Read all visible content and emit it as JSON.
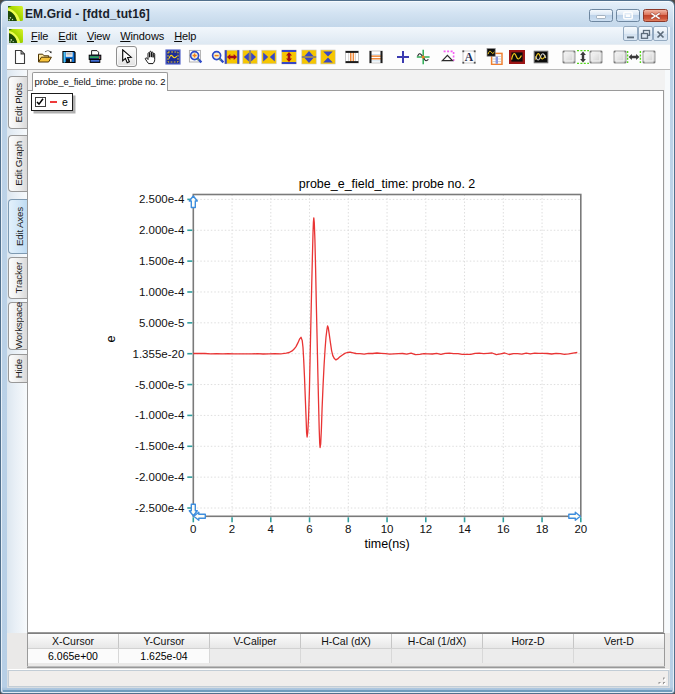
{
  "window": {
    "title": "EM.Grid - [fdtd_tut16]",
    "caption_buttons": [
      "minimize",
      "maximize",
      "close"
    ]
  },
  "menu": {
    "items": [
      {
        "label": "File",
        "underline": 0
      },
      {
        "label": "Edit",
        "underline": 0
      },
      {
        "label": "View",
        "underline": 0
      },
      {
        "label": "Windows",
        "underline": 0
      },
      {
        "label": "Help",
        "underline": 0
      }
    ],
    "mdi_buttons": [
      "minimize",
      "restore",
      "close"
    ]
  },
  "toolbar": {
    "buttons": [
      {
        "icon": "new-document"
      },
      {
        "icon": "open-folder"
      },
      {
        "icon": "save-floppy"
      },
      {
        "icon": "print"
      },
      {
        "icon": "select-arrow",
        "pressed": true
      },
      {
        "icon": "pan-hand"
      },
      {
        "icon": "zoom-region"
      },
      {
        "icon": "zoom-in"
      },
      {
        "icon": "zoom-out"
      },
      {
        "icon": "expand-x"
      },
      {
        "icon": "stretch-x"
      },
      {
        "icon": "shrink-x"
      },
      {
        "icon": "expand-y"
      },
      {
        "icon": "stretch-y"
      },
      {
        "icon": "shrink-y"
      },
      {
        "icon": "vertical-gridlines"
      },
      {
        "icon": "horizontal-gridlines"
      },
      {
        "icon": "crosshair"
      },
      {
        "icon": "tracker"
      },
      {
        "icon": "caliper"
      },
      {
        "icon": "text-annotation"
      },
      {
        "icon": "plot-table"
      },
      {
        "icon": "edit-plot"
      },
      {
        "icon": "overlay-plots"
      },
      {
        "icon": "align-box"
      },
      {
        "icon": "distribute-vertical"
      },
      {
        "icon": "align-box"
      },
      {
        "icon": "align-box"
      },
      {
        "icon": "distribute-horizontal"
      },
      {
        "icon": "align-box"
      }
    ]
  },
  "sidebar": {
    "tabs": [
      {
        "label": "Edit Plots",
        "selected": false
      },
      {
        "label": "Edit Graph",
        "selected": false
      },
      {
        "label": "Edit Axes",
        "selected": true
      },
      {
        "label": "Tracker",
        "selected": false
      },
      {
        "label": "Workspace",
        "selected": false
      },
      {
        "label": "Hide",
        "selected": false
      }
    ]
  },
  "document_tab": {
    "label": "probe_e_field_time: probe no. 2"
  },
  "legend": {
    "checked": true,
    "series_label": "e",
    "line_color": "#e93434"
  },
  "chart_data": {
    "type": "line",
    "title": "probe_e_field_time: probe no. 2",
    "xlabel": "time(ns)",
    "ylabel": "e",
    "xlim": [
      0,
      20
    ],
    "ylim": [
      -0.00026,
      0.000258
    ],
    "x_ticks": [
      0,
      2,
      4,
      6,
      8,
      10,
      12,
      14,
      16,
      18,
      20
    ],
    "y_ticks": [
      {
        "label": "2.500e-4",
        "value": 0.00025
      },
      {
        "label": "2.000e-4",
        "value": 0.0002
      },
      {
        "label": "1.500e-4",
        "value": 0.00015
      },
      {
        "label": "1.000e-4",
        "value": 0.0001
      },
      {
        "label": "5.000e-5",
        "value": 5e-05
      },
      {
        "label": "1.355e-20",
        "value": 0.0
      },
      {
        "label": "-5.000e-5",
        "value": -5e-05
      },
      {
        "label": "-1.000e-4",
        "value": -0.0001
      },
      {
        "label": "-1.500e-4",
        "value": -0.00015
      },
      {
        "label": "-2.000e-4",
        "value": -0.0002
      },
      {
        "label": "-2.500e-4",
        "value": -0.00025
      }
    ],
    "grid": "dotted",
    "legend_position": "floating-top-left",
    "series": [
      {
        "name": "e",
        "color": "#e93434",
        "points": [
          [
            0.0,
            4e-07
          ],
          [
            0.3,
            4e-07
          ],
          [
            0.6,
            4e-07
          ],
          [
            0.9,
            -4e-07
          ],
          [
            1.2,
            1e-07
          ],
          [
            1.5,
            -1e-07
          ],
          [
            1.8,
            0.0
          ],
          [
            2.1,
            -4e-07
          ],
          [
            2.4,
            -3e-07
          ],
          [
            2.7,
            -1e-07
          ],
          [
            3.0,
            -3e-07
          ],
          [
            3.3,
            -0.0
          ],
          [
            3.6,
            -5e-07
          ],
          [
            3.9,
            -4e-07
          ],
          [
            4.2,
            2e-07
          ],
          [
            4.5,
            -1e-07
          ],
          [
            4.6,
            0.0
          ],
          [
            4.8,
            8e-07
          ],
          [
            4.95,
            2e-06
          ],
          [
            5.1,
            4.5e-06
          ],
          [
            5.2,
            7.5e-06
          ],
          [
            5.3,
            1.15e-05
          ],
          [
            5.4,
            1.75e-05
          ],
          [
            5.48,
            2.35e-05
          ],
          [
            5.56,
            2.65e-05
          ],
          [
            5.62,
            2.15e-05
          ],
          [
            5.66,
            1e-05
          ],
          [
            5.7,
            -1e-05
          ],
          [
            5.74,
            -3.8e-05
          ],
          [
            5.78,
            -7.2e-05
          ],
          [
            5.82,
            -0.000105
          ],
          [
            5.85,
            -0.000128
          ],
          [
            5.875,
            -0.000135
          ],
          [
            5.91,
            -0.000127
          ],
          [
            5.95,
            -0.000102
          ],
          [
            5.99,
            -6e-05
          ],
          [
            6.03,
            -7e-06
          ],
          [
            6.07,
            5.2e-05
          ],
          [
            6.11,
            0.00011
          ],
          [
            6.145,
            0.000157
          ],
          [
            6.18,
            0.000195
          ],
          [
            6.2,
            0.000213
          ],
          [
            6.22,
            0.00022
          ],
          [
            6.245,
            0.000212
          ],
          [
            6.275,
            0.000185
          ],
          [
            6.31,
            0.000138
          ],
          [
            6.35,
            8.2e-05
          ],
          [
            6.39,
            2.5e-05
          ],
          [
            6.43,
            -3.5e-05
          ],
          [
            6.465,
            -8.2e-05
          ],
          [
            6.5,
            -0.000122
          ],
          [
            6.525,
            -0.000145
          ],
          [
            6.545,
            -0.000152
          ],
          [
            6.575,
            -0.000146
          ],
          [
            6.61,
            -0.000122
          ],
          [
            6.65,
            -8.8e-05
          ],
          [
            6.7,
            -5e-05
          ],
          [
            6.75,
            -1.8e-05
          ],
          [
            6.8,
            8e-06
          ],
          [
            6.85,
            2.7e-05
          ],
          [
            6.9,
            4e-05
          ],
          [
            6.93,
            4.5e-05
          ],
          [
            6.97,
            4.2e-05
          ],
          [
            7.02,
            3.1e-05
          ],
          [
            7.08,
            1.7e-05
          ],
          [
            7.14,
            5e-06
          ],
          [
            7.2,
            -3e-06
          ],
          [
            7.28,
            -8e-06
          ],
          [
            7.36,
            -1e-05
          ],
          [
            7.45,
            -8.5e-06
          ],
          [
            7.55,
            -5.5e-06
          ],
          [
            7.68,
            -2.5e-06
          ],
          [
            7.82,
            5e-07
          ],
          [
            7.95,
            2e-06
          ],
          [
            8.1,
            2.5e-06
          ],
          [
            8.25,
            1.5e-06
          ],
          [
            8.4,
            4e-07
          ],
          [
            8.6,
            0.0
          ],
          [
            8.82,
            -6e-07
          ],
          [
            9.04,
            7e-07
          ],
          [
            9.26,
            4e-07
          ],
          [
            9.48,
            1.2e-06
          ],
          [
            9.7,
            7e-07
          ],
          [
            9.92,
            2e-07
          ],
          [
            10.14,
            -8e-07
          ],
          [
            10.36,
            -1e-07
          ],
          [
            10.58,
            2e-07
          ],
          [
            10.8,
            4e-07
          ],
          [
            11.02,
            -8e-07
          ],
          [
            11.24,
            8e-07
          ],
          [
            11.46,
            -1.7e-06
          ],
          [
            11.68,
            -1.2e-06
          ],
          [
            11.9,
            2e-07
          ],
          [
            12.12,
            -4e-07
          ],
          [
            12.34,
            -5e-07
          ],
          [
            12.56,
            7e-07
          ],
          [
            12.78,
            -1.1e-06
          ],
          [
            13.0,
            7e-07
          ],
          [
            13.22,
            9e-07
          ],
          [
            13.44,
            1e-07
          ],
          [
            13.66,
            2e-07
          ],
          [
            13.88,
            -9e-07
          ],
          [
            14.1,
            -1.2e-06
          ],
          [
            14.32,
            -1.2e-06
          ],
          [
            14.54,
            5e-07
          ],
          [
            14.76,
            8e-07
          ],
          [
            14.98,
            1e-07
          ],
          [
            15.2,
            6e-07
          ],
          [
            15.42,
            1.2e-06
          ],
          [
            15.64,
            -1.4e-06
          ],
          [
            15.86,
            -1e-07
          ],
          [
            16.08,
            1.1e-06
          ],
          [
            16.3,
            -1.3e-06
          ],
          [
            16.52,
            1e-07
          ],
          [
            16.74,
            1e-07
          ],
          [
            16.96,
            -6e-07
          ],
          [
            17.18,
            1e-06
          ],
          [
            17.4,
            -4e-07
          ],
          [
            17.62,
            8e-07
          ],
          [
            17.84,
            5e-07
          ],
          [
            18.06,
            5e-07
          ],
          [
            18.28,
            4e-07
          ],
          [
            18.5,
            -5e-07
          ],
          [
            18.72,
            7e-07
          ],
          [
            18.94,
            1e-07
          ],
          [
            19.16,
            -1e-06
          ],
          [
            19.38,
            -4e-07
          ],
          [
            19.6,
            9e-07
          ],
          [
            19.82,
            2e-06
          ]
        ]
      }
    ]
  },
  "readout": {
    "columns": [
      "X-Cursor",
      "Y-Cursor",
      "V-Caliper",
      "H-Cal (dX)",
      "H-Cal (1/dX)",
      "Horz-D",
      "Vert-D"
    ],
    "values": [
      "6.065e+00",
      "1.625e-04",
      "",
      "",
      "",
      "",
      ""
    ]
  }
}
